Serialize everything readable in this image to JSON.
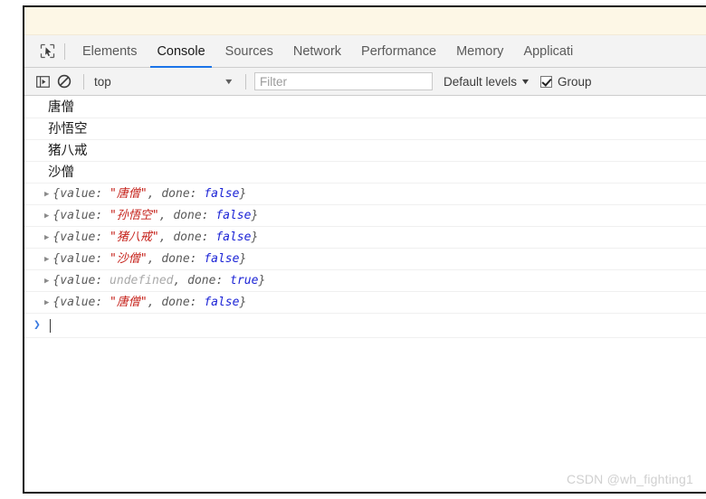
{
  "window": {
    "page_sliver_color": "#fdf7e6"
  },
  "tabbar": {
    "inspect_icon": "inspect-element-icon",
    "tabs": [
      {
        "label": "Elements",
        "active": false
      },
      {
        "label": "Console",
        "active": true
      },
      {
        "label": "Sources",
        "active": false
      },
      {
        "label": "Network",
        "active": false
      },
      {
        "label": "Performance",
        "active": false
      },
      {
        "label": "Memory",
        "active": false
      },
      {
        "label": "Applicati",
        "active": false
      }
    ],
    "active_tab": "Console",
    "active_underline_color": "#1a73e8"
  },
  "toolbar": {
    "sidebar_icon": "console-sidebar-icon",
    "clear_icon": "clear-console-icon",
    "context_value": "top",
    "context_caret": "▼",
    "filter_placeholder": "Filter",
    "filter_value": "",
    "levels_label": "Default levels",
    "levels_caret": "▼",
    "group_similar_label": "Group",
    "group_similar_checked": true
  },
  "console": {
    "rows": [
      {
        "kind": "text",
        "text": "唐僧"
      },
      {
        "kind": "text",
        "text": "孙悟空"
      },
      {
        "kind": "text",
        "text": "猪八戒"
      },
      {
        "kind": "text",
        "text": "沙僧"
      },
      {
        "kind": "object",
        "arrow": "▶",
        "open": "{value: ",
        "value": "\"唐僧\"",
        "value_type": "string",
        "mid": ", done: ",
        "done": "false",
        "done_type": "boolean",
        "close": "}"
      },
      {
        "kind": "object",
        "arrow": "▶",
        "open": "{value: ",
        "value": "\"孙悟空\"",
        "value_type": "string",
        "mid": ", done: ",
        "done": "false",
        "done_type": "boolean",
        "close": "}"
      },
      {
        "kind": "object",
        "arrow": "▶",
        "open": "{value: ",
        "value": "\"猪八戒\"",
        "value_type": "string",
        "mid": ", done: ",
        "done": "false",
        "done_type": "boolean",
        "close": "}"
      },
      {
        "kind": "object",
        "arrow": "▶",
        "open": "{value: ",
        "value": "\"沙僧\"",
        "value_type": "string",
        "mid": ", done: ",
        "done": "false",
        "done_type": "boolean",
        "close": "}"
      },
      {
        "kind": "object",
        "arrow": "▶",
        "open": "{value: ",
        "value": "undefined",
        "value_type": "undefined",
        "mid": ", done: ",
        "done": "true",
        "done_type": "boolean",
        "close": "}"
      },
      {
        "kind": "object",
        "arrow": "▶",
        "open": "{value: ",
        "value": "\"唐僧\"",
        "value_type": "string",
        "mid": ", done: ",
        "done": "false",
        "done_type": "boolean",
        "close": "}"
      }
    ]
  },
  "prompt": {
    "chevron": "❯",
    "input_value": ""
  },
  "watermark": {
    "text": "CSDN @wh_fighting1"
  },
  "colors": {
    "string": "#c5211a",
    "boolean": "#1c24d6",
    "undefined": "#a9a9a9",
    "accent": "#1a73e8",
    "chrome_bg": "#f3f3f3"
  }
}
